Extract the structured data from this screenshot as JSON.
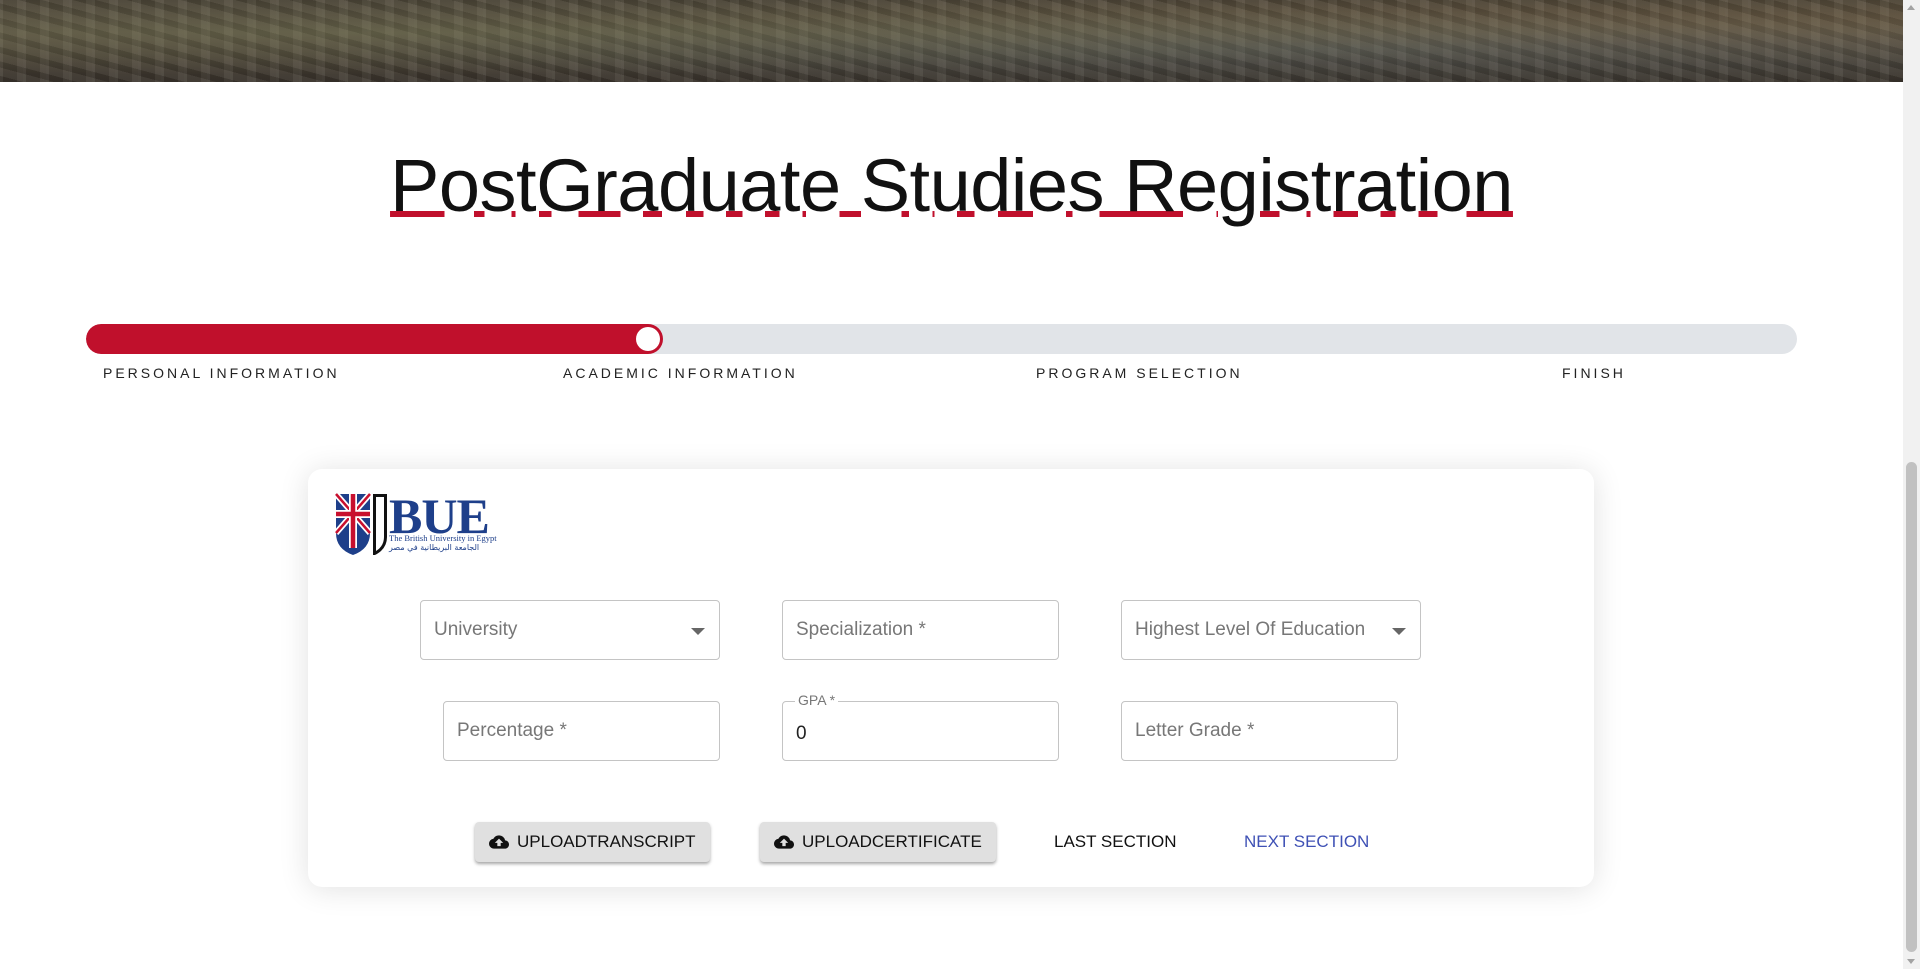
{
  "header": {
    "title": "PostGraduate Studies Registration"
  },
  "stepper": {
    "progress": 0.337,
    "steps": [
      {
        "label": "PERSONAL INFORMATION"
      },
      {
        "label": "ACADEMIC INFORMATION"
      },
      {
        "label": "PROGRAM SELECTION"
      },
      {
        "label": "FINISH"
      }
    ],
    "colors": {
      "active": "#c0102c",
      "track": "#e1e4e8"
    }
  },
  "logo": {
    "wordmark": "BUE",
    "english": "The British University in Egypt",
    "arabic": "الجامعة البريطانية في مصر"
  },
  "form": {
    "university": {
      "placeholder": "University"
    },
    "specialization": {
      "placeholder": "Specialization *"
    },
    "education": {
      "placeholder": "Highest Level Of Education"
    },
    "percentage": {
      "placeholder": "Percentage *"
    },
    "gpa": {
      "label": "GPA *",
      "value": "0"
    },
    "letter_grade": {
      "placeholder": "Letter Grade *"
    }
  },
  "actions": {
    "upload_transcript": "UPLOADTRANSCRIPT",
    "upload_certificate": "UPLOADCERTIFICATE",
    "last_section": "LAST SECTION",
    "next_section": "NEXT SECTION",
    "next_color": "#3f51b5"
  }
}
